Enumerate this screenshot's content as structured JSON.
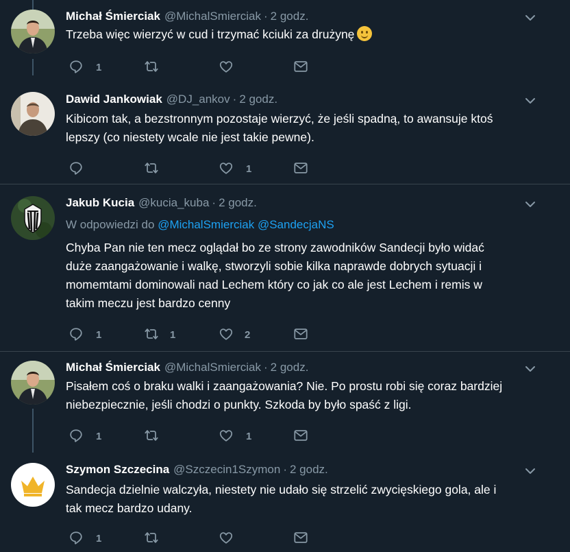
{
  "colors": {
    "background": "#15202b",
    "secondary_text": "#8899a6",
    "link": "#1da1f2",
    "thread_line": "#3d5466",
    "divider": "#38444d"
  },
  "tweets": [
    {
      "name": "Michał Śmierciak",
      "handle": "@MichalSmierciak",
      "sep": "·",
      "time": "2 godz.",
      "text": "Trzeba więc wierzyć w cud i trzymać kciuki za drużynę",
      "emoji": "slightly-smiling-face-icon",
      "reply_count": "1",
      "retweet_count": "",
      "like_count": ""
    },
    {
      "name": "Dawid Jankowiak",
      "handle": "@DJ_ankov",
      "sep": "·",
      "time": "2 godz.",
      "text_line1": "Kibicom tak, a bezstronnym pozostaje wierzyć, że jeśli spadną, to awansuje ktoś",
      "text_line2": "lepszy (co niestety wcale nie jest takie pewne).",
      "reply_count": "",
      "retweet_count": "",
      "like_count": "1"
    },
    {
      "name": "Jakub Kucia",
      "handle": "@kucia_kuba",
      "sep": "·",
      "time": "2 godz.",
      "reply_prefix": "W odpowiedzi do",
      "reply_user1": "@MichalSmierciak",
      "reply_user2": "@SandecjaNS",
      "text_line1": "Chyba Pan nie ten mecz oglądał bo ze strony zawodników Sandecji było widać",
      "text_line2": "duże zaangażowanie i walkę, stworzyli sobie kilka naprawde dobrych sytuacji i",
      "text_line3": "momemtami dominowali nad Lechem który co jak co ale jest Lechem i remis w",
      "text_line4": "takim meczu jest bardzo cenny",
      "reply_count": "1",
      "retweet_count": "1",
      "like_count": "2"
    },
    {
      "name": "Michał Śmierciak",
      "handle": "@MichalSmierciak",
      "sep": "·",
      "time": "2 godz.",
      "text_line1": "Pisałem coś o braku walki i zaangażowania? Nie. Po prostu robi się coraz bardziej",
      "text_line2": "niebezpiecznie, jeśli chodzi o punkty. Szkoda by było spaść z ligi.",
      "reply_count": "1",
      "retweet_count": "",
      "like_count": "1"
    },
    {
      "name": "Szymon Szczecina",
      "handle": "@Szczecin1Szymon",
      "sep": "·",
      "time": "2 godz.",
      "text_line1": "Sandecja dzielnie walczyła, niestety nie udało się strzelić zwycięskiego gola, ale i",
      "text_line2": "tak mecz bardzo udany.",
      "reply_count": "1",
      "retweet_count": "",
      "like_count": ""
    }
  ]
}
